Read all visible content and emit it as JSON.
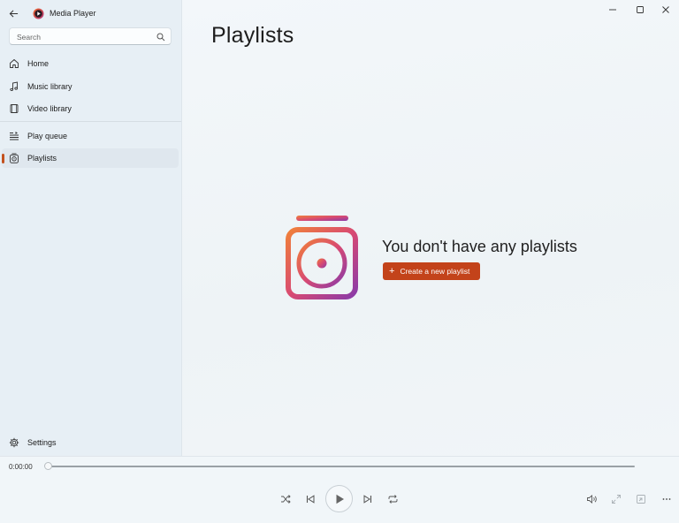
{
  "app": {
    "title": "Media Player"
  },
  "search": {
    "placeholder": "Search",
    "value": ""
  },
  "sidebar": {
    "items": [
      {
        "label": "Home",
        "icon": "home-icon"
      },
      {
        "label": "Music library",
        "icon": "music-note-icon"
      },
      {
        "label": "Video library",
        "icon": "film-icon"
      },
      {
        "label": "Play queue",
        "icon": "queue-icon"
      },
      {
        "label": "Playlists",
        "icon": "playlist-icon",
        "active": true
      }
    ],
    "settings_label": "Settings"
  },
  "main": {
    "page_title": "Playlists",
    "empty_message": "You don't have any playlists",
    "create_button_label": "Create a new playlist"
  },
  "player": {
    "current_time": "0:00:00",
    "progress": 0
  },
  "colors": {
    "accent": "#c3431a",
    "sidebar_bg": "#e7eff5",
    "main_bg": "#f1f5f8"
  }
}
